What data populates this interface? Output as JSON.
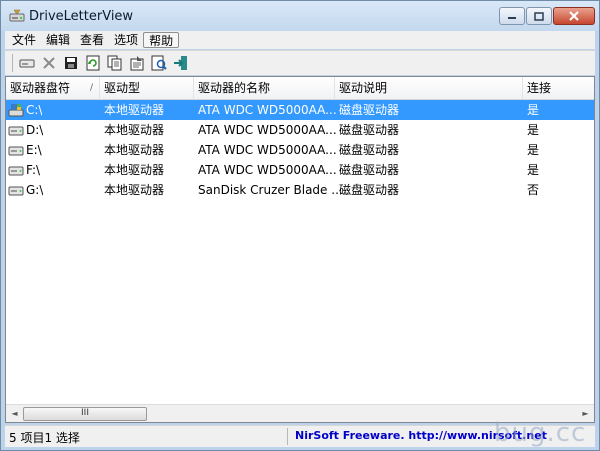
{
  "window": {
    "title": "DriveLetterView"
  },
  "menu": [
    "文件",
    "编辑",
    "查看",
    "选项",
    "帮助"
  ],
  "toolbar": [
    {
      "name": "drive-icon"
    },
    {
      "name": "delete-icon"
    },
    {
      "name": "save-icon"
    },
    {
      "name": "refresh-icon"
    },
    {
      "name": "copy-icon"
    },
    {
      "name": "properties-icon"
    },
    {
      "name": "report-icon"
    },
    {
      "name": "exit-icon"
    }
  ],
  "columns": [
    "驱动器盘符",
    "驱动型",
    "驱动器的名称",
    "驱动说明",
    "连接"
  ],
  "sort_indicator": "/",
  "rows": [
    {
      "letter": "C:\\",
      "type": "本地驱动器",
      "name": "ATA WDC WD5000AA...",
      "desc": "磁盘驱动器",
      "connected": "是",
      "selected": true
    },
    {
      "letter": "D:\\",
      "type": "本地驱动器",
      "name": "ATA WDC WD5000AA...",
      "desc": "磁盘驱动器",
      "connected": "是",
      "selected": false
    },
    {
      "letter": "E:\\",
      "type": "本地驱动器",
      "name": "ATA WDC WD5000AA...",
      "desc": "磁盘驱动器",
      "connected": "是",
      "selected": false
    },
    {
      "letter": "F:\\",
      "type": "本地驱动器",
      "name": "ATA WDC WD5000AA...",
      "desc": "磁盘驱动器",
      "connected": "是",
      "selected": false
    },
    {
      "letter": "G:\\",
      "type": "本地驱动器",
      "name": "SanDisk Cruzer Blade ...",
      "desc": "磁盘驱动器",
      "connected": "否",
      "selected": false
    }
  ],
  "scrollbar": {
    "left_arrow": "◄",
    "right_arrow": "►",
    "grip": "III"
  },
  "status": {
    "count": "5 项目1 选择",
    "link": "NirSoft Freeware.  http://www.nirsoft.net"
  },
  "watermark": "bug.cc",
  "colors": {
    "selection": "#3399ff",
    "title_bg": "#c3d8ee",
    "link": "#0000cc"
  }
}
